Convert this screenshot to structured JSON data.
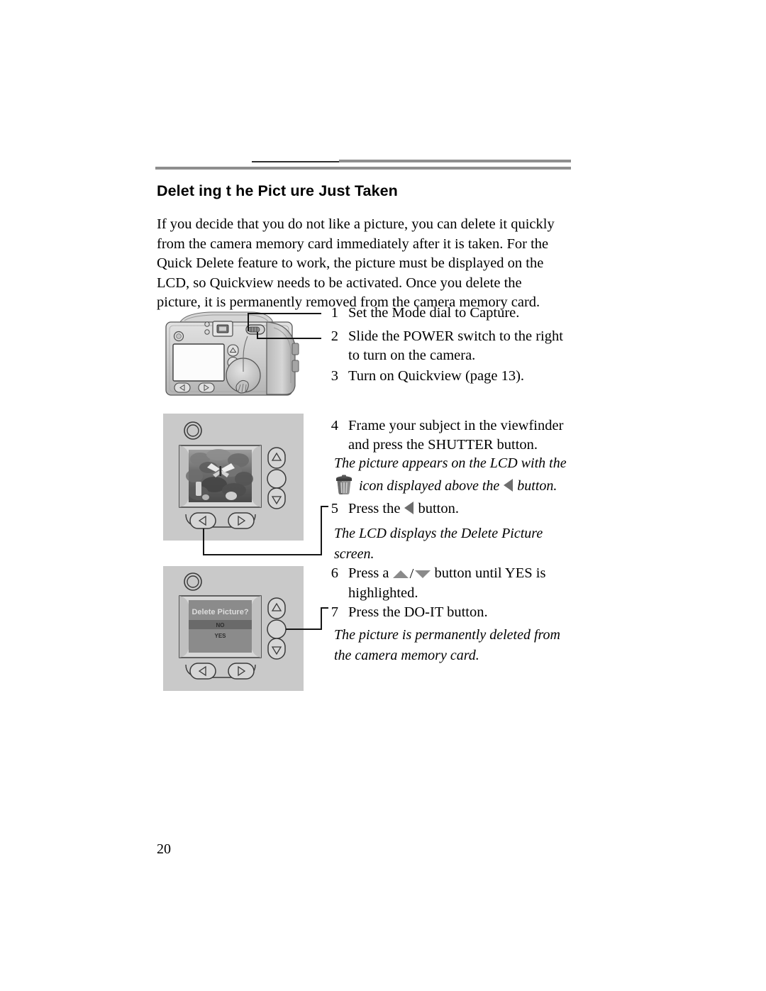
{
  "document": {
    "heading": "Delet ing t he Pict ure Just  Taken",
    "page_number": "20",
    "intro": "If you decide that you do not like a picture, you can delete it quickly from the camera memory card immediately after it is taken. For the Quick Delete feature to work, the picture must be displayed on the LCD, so Quickview needs to be activated. Once you delete the picture, it is permanently removed from the camera memory card."
  },
  "steps": [
    {
      "num": "1",
      "text": "Set the Mode dial to Capture."
    },
    {
      "num": "2",
      "text": "Slide the POWER switch to the right to turn on the camera."
    },
    {
      "num": "3",
      "text": "Turn on Quickview (page 13)."
    },
    {
      "num": "4",
      "text": "Frame your subject in the viewfinder and press the SHUTTER button."
    },
    {
      "num": "5",
      "text_before": "Press the",
      "text_after": "button."
    },
    {
      "num": "6",
      "text_before": "Press a",
      "text_after": "button until YES is highlighted."
    },
    {
      "num": "7",
      "text": "Press the DO-IT button."
    }
  ],
  "notes": {
    "note4_line1": "The picture appears on the LCD with the",
    "note4_line2_before": "icon displayed above the",
    "note4_line2_after": "button.",
    "note5": "The LCD displays the Delete Picture screen.",
    "note7": "The picture is permanently deleted from the camera memory card."
  },
  "icons": {
    "trash": "trash-can-icon",
    "left_arrow": "left-triangle-icon",
    "up_arrow": "up-triangle-icon",
    "down_arrow": "down-triangle-icon"
  },
  "lcd_screen": {
    "title": "Delete Picture?",
    "option_highlighted": "NO",
    "option_second": "YES"
  },
  "colors": {
    "panel_background": "#c9c9c9",
    "rule_dark": "#2f2f2f",
    "rule_gray": "#8e8e8e",
    "glyph_gray": "#8a8a8a",
    "lcd_screen_bg": "#8b8b8b",
    "lcd_highlight": "#6a6a6a",
    "text": "#000000"
  }
}
